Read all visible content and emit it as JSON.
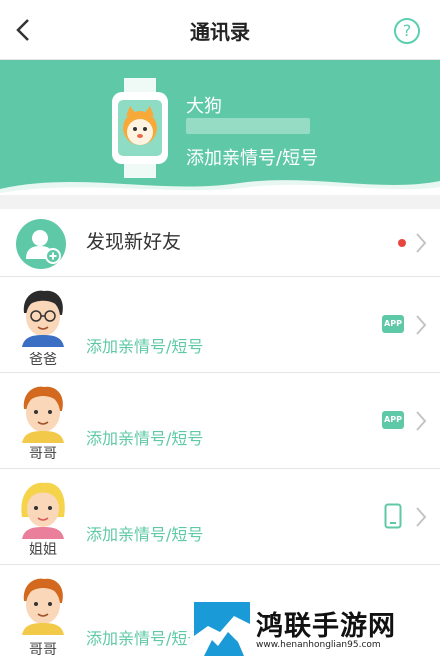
{
  "header": {
    "title": "通讯录",
    "help_glyph": "?"
  },
  "device": {
    "name": "大狗",
    "action": "添加亲情号/短号"
  },
  "discover": {
    "label": "发现新好友",
    "indicator_color": "#e8463d"
  },
  "contacts": [
    {
      "role": "爸爸",
      "action": "添加亲情号/短号",
      "device": "APP"
    },
    {
      "role": "哥哥",
      "action": "添加亲情号/短号",
      "device": "APP"
    },
    {
      "role": "姐姐",
      "action": "添加亲情号/短号",
      "device": "phone"
    },
    {
      "role": "哥哥",
      "action": "添加亲情号/短号",
      "device": "APP"
    }
  ],
  "watermark": {
    "brand": "鸿联手游网",
    "url": "www.henanhonglian95.com"
  },
  "colors": {
    "accent": "#5fc9a7",
    "divider": "#e6e6e6"
  }
}
